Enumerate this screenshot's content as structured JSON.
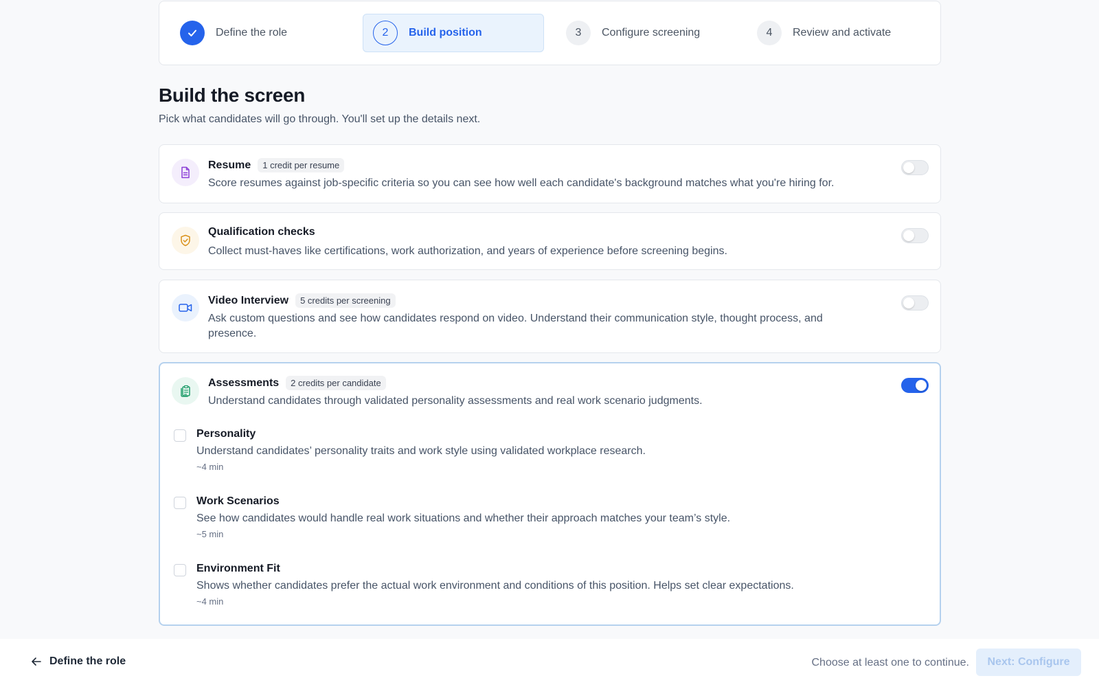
{
  "stepper": {
    "steps": [
      {
        "number": "",
        "label": "Define the role",
        "state": "done"
      },
      {
        "number": "2",
        "label": "Build position",
        "state": "current"
      },
      {
        "number": "3",
        "label": "Configure screening",
        "state": "todo"
      },
      {
        "number": "4",
        "label": "Review and activate",
        "state": "todo"
      }
    ]
  },
  "page": {
    "title": "Build the screen",
    "subtitle": "Pick what candidates will go through. You'll set up the details next."
  },
  "options": {
    "resume": {
      "title": "Resume",
      "badge": "1 credit per resume",
      "description": "Score resumes against job-specific criteria so you can see how well each candidate's background matches what you're hiring for.",
      "enabled": false,
      "icon": "document-icon"
    },
    "qualification": {
      "title": "Qualification checks",
      "description": "Collect must-haves like certifications, work authorization, and years of experience before screening begins.",
      "enabled": false,
      "icon": "shield-check-icon"
    },
    "video": {
      "title": "Video Interview",
      "badge": "5 credits per screening",
      "description": "Ask custom questions and see how candidates respond on video. Understand their communication style, thought process, and presence.",
      "enabled": false,
      "icon": "video-camera-icon"
    },
    "assessments": {
      "title": "Assessments",
      "badge": "2 credits per candidate",
      "description": "Understand candidates through validated personality assessments and real work scenario judgments.",
      "enabled": true,
      "icon": "clipboard-icon",
      "items": [
        {
          "title": "Personality",
          "description": "Understand candidates’ personality traits and work style using validated workplace research.",
          "time": "~4 min",
          "checked": false
        },
        {
          "title": "Work Scenarios",
          "description": "See how candidates would handle real work situations and whether their approach matches your team’s style.",
          "time": "~5 min",
          "checked": false
        },
        {
          "title": "Environment Fit",
          "description": "Shows whether candidates prefer the actual work environment and conditions of this position. Helps set clear expectations.",
          "time": "~4 min",
          "checked": false
        }
      ]
    }
  },
  "footer": {
    "back_label": "Define the role",
    "hint": "Choose at least one to continue.",
    "next_label": "Next: Configure"
  },
  "colors": {
    "accent": "#2563eb",
    "resume_icon": "#8b3fd6",
    "qualification_icon": "#d9911a",
    "video_icon": "#2563eb",
    "assessments_icon": "#1f9d6b"
  }
}
